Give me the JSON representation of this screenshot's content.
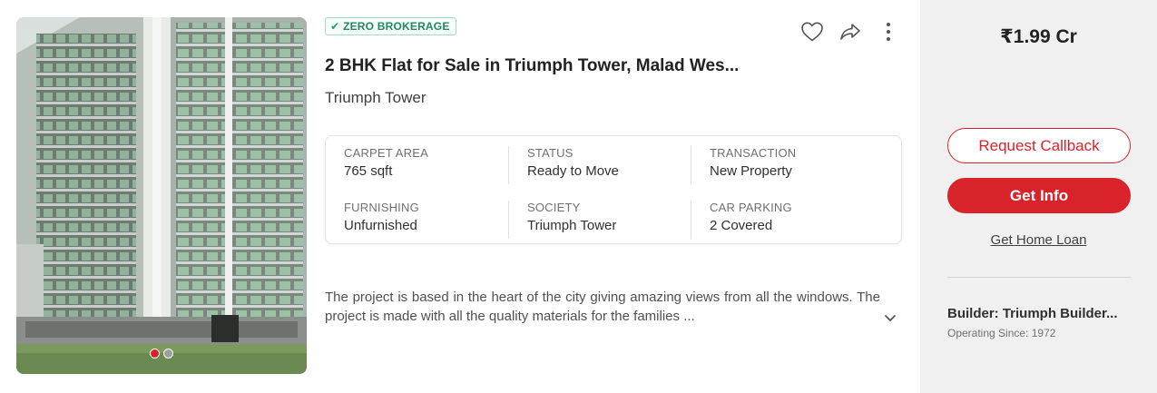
{
  "listing": {
    "badge": "ZERO BROKERAGE",
    "title": "2 BHK Flat for Sale in Triumph Tower, Malad Wes...",
    "project": "Triumph Tower",
    "description": "The project is based in the heart of the city giving amazing views from all the windows. The project is made with all the quality materials for the families ...",
    "photo_dots": {
      "total": 2,
      "active_index": 0
    }
  },
  "icons": {
    "badge": "check-icon",
    "shortlist": "heart-outline-icon",
    "share": "share-arrow-icon",
    "more": "more-vertical-icon",
    "expand": "chevron-down-icon"
  },
  "specs": [
    {
      "label": "CARPET AREA",
      "value": "765 sqft"
    },
    {
      "label": "STATUS",
      "value": "Ready to Move"
    },
    {
      "label": "TRANSACTION",
      "value": "New Property"
    },
    {
      "label": "FURNISHING",
      "value": "Unfurnished"
    },
    {
      "label": "SOCIETY",
      "value": "Triumph Tower"
    },
    {
      "label": "CAR PARKING",
      "value": "2 Covered"
    }
  ],
  "sidebar": {
    "price": "₹1.99 Cr",
    "request_callback": "Request Callback",
    "get_info": "Get Info",
    "home_loan": "Get Home Loan",
    "builder": "Builder: Triumph Builder...",
    "operating_since": "Operating Since: 1972"
  },
  "colors": {
    "accent": "#d8232a",
    "badge_green": "#1f8a62",
    "side_bg": "#f0f0f0"
  }
}
